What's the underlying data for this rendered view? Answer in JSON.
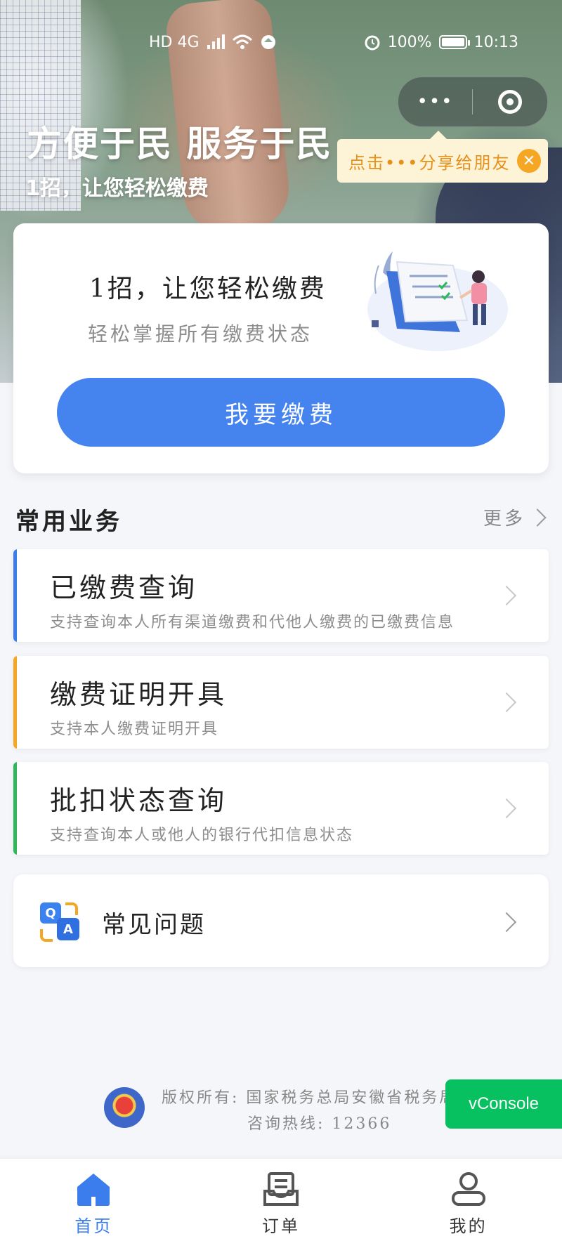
{
  "status_bar": {
    "network": "HD 4G",
    "battery": "100%",
    "time": "10:13"
  },
  "mini_program_capsule": {
    "more_icon": "more-dots-icon",
    "close_icon": "target-circle-icon"
  },
  "share_tip": {
    "text": "点击•••分享给朋友",
    "close_icon": "close-icon"
  },
  "banner": {
    "title": "方便于民 服务于民",
    "subtitle": "1招，让您轻松缴费"
  },
  "main_card": {
    "title": "1招，让您轻松缴费",
    "subtitle": "轻松掌握所有缴费状态",
    "button_label": "我要缴费",
    "button_color": "#4583ee"
  },
  "common_services": {
    "heading": "常用业务",
    "more_label": "更多",
    "items": [
      {
        "title": "已缴费查询",
        "desc": "支持查询本人所有渠道缴费和代他人缴费的已缴费信息",
        "accent": "#3b7ded"
      },
      {
        "title": "缴费证明开具",
        "desc": "支持本人缴费证明开具",
        "accent": "#f5a623"
      },
      {
        "title": "批扣状态查询",
        "desc": "支持查询本人或他人的银行代扣信息状态",
        "accent": "#2fb85a"
      }
    ]
  },
  "faq": {
    "label": "常见问题",
    "icon": "qa-icon"
  },
  "footer": {
    "copyright": "版权所有: 国家税务总局安徽省税务局",
    "hotline": "咨询热线: 12366"
  },
  "vconsole": {
    "label": "vConsole"
  },
  "tab_bar": {
    "items": [
      {
        "label": "首页",
        "icon": "home-icon",
        "active": true
      },
      {
        "label": "订单",
        "icon": "order-icon",
        "active": false
      },
      {
        "label": "我的",
        "icon": "user-icon",
        "active": false
      }
    ]
  }
}
